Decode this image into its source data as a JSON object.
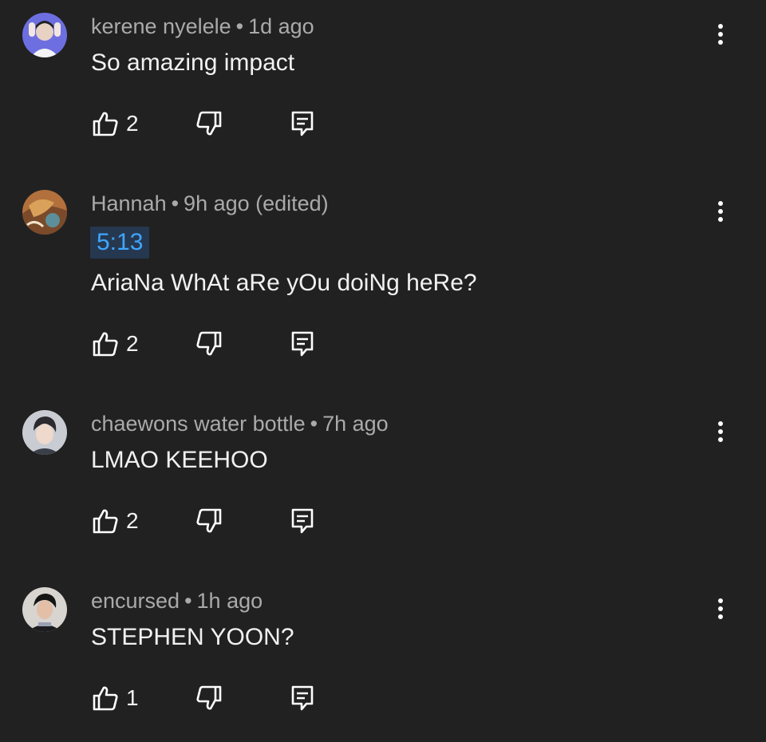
{
  "comments": [
    {
      "author": "kerene nyelele",
      "time": "1d ago",
      "timestamp_link": "",
      "text": "So amazing impact",
      "likes": "2",
      "avatar_icon": "avatar-purple-hands"
    },
    {
      "author": "Hannah",
      "time": "9h ago (edited)",
      "timestamp_link": "5:13",
      "text": "AriaNa WhAt aRe yOu doiNg heRe?",
      "likes": "2",
      "avatar_icon": "avatar-orange-painting"
    },
    {
      "author": "chaewons water bottle",
      "time": "7h ago",
      "timestamp_link": "",
      "text": "LMAO KEEHOO",
      "likes": "2",
      "avatar_icon": "avatar-grey-portrait"
    },
    {
      "author": "encursed",
      "time": "1h ago",
      "timestamp_link": "",
      "text": "STEPHEN YOON?",
      "likes": "1",
      "avatar_icon": "avatar-dark-portrait"
    }
  ],
  "separator": "•",
  "colors": {
    "background": "#212121",
    "meta": "#aaaaaa",
    "text": "#f1f1f1",
    "link": "#3ea6ff",
    "link_bg": "#263850"
  }
}
